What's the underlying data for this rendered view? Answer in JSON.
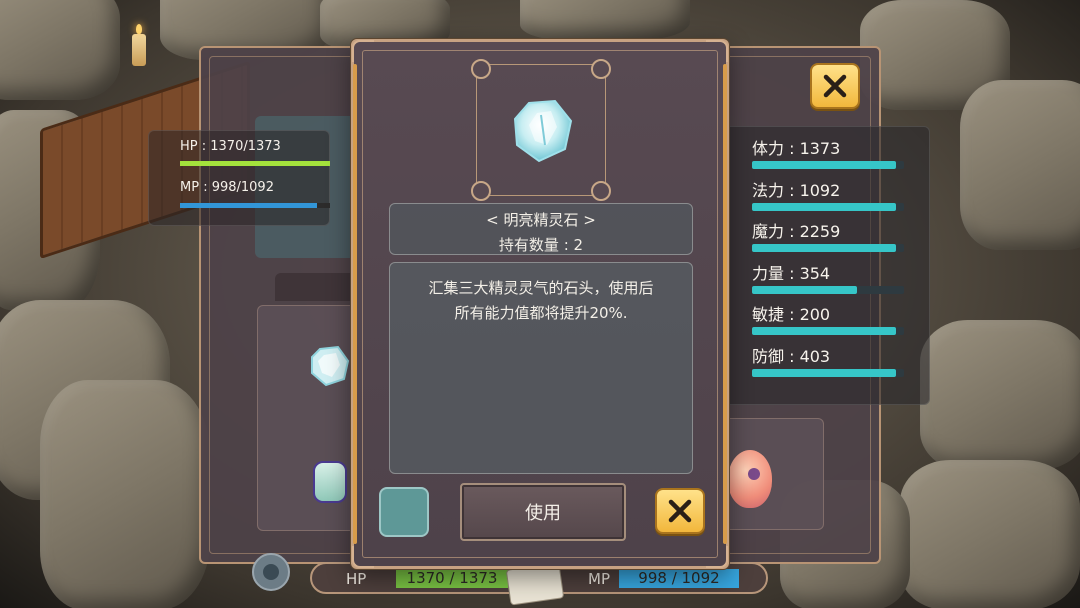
{
  "hud": {
    "hp_text": "HP : 1370/1373",
    "mp_text": "MP : 998/1092",
    "hp_fraction": 0.998,
    "mp_fraction": 0.914,
    "hp_color": "#a4e23c",
    "mp_color": "#3296d8"
  },
  "stats": [
    {
      "label": "体力 : 1373",
      "fill": 0.95
    },
    {
      "label": "法力 : 1092",
      "fill": 0.95
    },
    {
      "label": "魔力 : 2259",
      "fill": 0.95
    },
    {
      "label": "力量 : 354",
      "fill": 0.69
    },
    {
      "label": "敏捷 : 200",
      "fill": 0.95
    },
    {
      "label": "防御 : 403",
      "fill": 0.95
    }
  ],
  "item": {
    "name": "< 明亮精灵石 >",
    "quantity": "持有数量 : 2",
    "description_line1": "汇集三大精灵灵气的石头，使用后",
    "description_line2": "所有能力值都将提升20%.",
    "icon": "spirit-crystal-icon"
  },
  "popup": {
    "use_label": "使用",
    "close_icon": "close-x-icon"
  },
  "bottom_bar": {
    "hp_label": "HP",
    "hp_value": "1370 / 1373",
    "mp_label": "MP",
    "mp_value": "998 / 1092"
  },
  "colors": {
    "accent_gold": "#f2b73c",
    "stat_bar": "#36c6c8",
    "hp_green": "#79c243",
    "mp_blue": "#37a7e0"
  }
}
